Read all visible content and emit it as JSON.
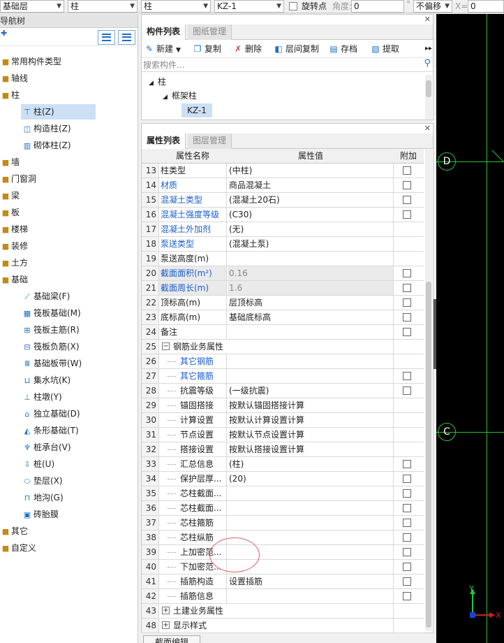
{
  "toolbar": {
    "floor": "基础层",
    "category": "柱",
    "type": "柱",
    "component": "KZ-1",
    "rotate_point": "旋转点",
    "angle_label": "角度:",
    "angle_value": "0",
    "degree": "°",
    "offset": "不偏移",
    "x_label": "X=",
    "x_value": "0"
  },
  "nav": {
    "title": "导航树",
    "items": [
      {
        "label": "常用构件类型"
      },
      {
        "label": "轴线"
      },
      {
        "label": "柱"
      },
      {
        "label": "柱(Z)"
      },
      {
        "label": "构造柱(Z)"
      },
      {
        "label": "砌体柱(Z)"
      },
      {
        "label": "墙"
      },
      {
        "label": "门窗洞"
      },
      {
        "label": "梁"
      },
      {
        "label": "板"
      },
      {
        "label": "楼梯"
      },
      {
        "label": "装修"
      },
      {
        "label": "土方"
      },
      {
        "label": "基础"
      },
      {
        "label": "基础梁(F)"
      },
      {
        "label": "筏板基础(M)"
      },
      {
        "label": "筏板主筋(R)"
      },
      {
        "label": "筏板负筋(X)"
      },
      {
        "label": "基础板带(W)"
      },
      {
        "label": "集水坑(K)"
      },
      {
        "label": "柱墩(Y)"
      },
      {
        "label": "独立基础(D)"
      },
      {
        "label": "条形基础(T)"
      },
      {
        "label": "桩承台(V)"
      },
      {
        "label": "桩(U)"
      },
      {
        "label": "垫层(X)"
      },
      {
        "label": "地沟(G)"
      },
      {
        "label": "砖胎膜"
      },
      {
        "label": "其它"
      },
      {
        "label": "自定义"
      }
    ]
  },
  "component_panel": {
    "tab_active": "构件列表",
    "tab_other": "图纸管理",
    "actions": {
      "new": "新建",
      "copy": "复制",
      "delete": "删除",
      "floor_copy": "层间复制",
      "save": "存档",
      "extract": "提取"
    },
    "search_placeholder": "搜索构件...",
    "tree": {
      "root": "柱",
      "child": "框架柱",
      "leaf": "KZ-1"
    }
  },
  "property_panel": {
    "tab_active": "属性列表",
    "tab_other": "图层管理",
    "headers": {
      "name": "属性名称",
      "value": "属性值",
      "extra": "附加"
    },
    "rows": [
      {
        "n": "13",
        "name": "柱类型",
        "value": "(中柱)"
      },
      {
        "n": "14",
        "name": "材质",
        "value": "商品混凝土"
      },
      {
        "n": "15",
        "name": "混凝土类型",
        "value": "(混凝土20石)"
      },
      {
        "n": "16",
        "name": "混凝土强度等级",
        "value": "(C30)"
      },
      {
        "n": "17",
        "name": "混凝土外加剂",
        "value": "(无)"
      },
      {
        "n": "18",
        "name": "泵送类型",
        "value": "(混凝土泵)"
      },
      {
        "n": "19",
        "name": "泵送高度(m)",
        "value": ""
      },
      {
        "n": "20",
        "name": "截面面积(m²)",
        "value": "0.16"
      },
      {
        "n": "21",
        "name": "截面周长(m)",
        "value": "1.6"
      },
      {
        "n": "22",
        "name": "顶标高(m)",
        "value": "层顶标高"
      },
      {
        "n": "23",
        "name": "底标高(m)",
        "value": "基础底标高"
      },
      {
        "n": "24",
        "name": "备注",
        "value": ""
      },
      {
        "n": "25",
        "name": "钢筋业务属性",
        "value": ""
      },
      {
        "n": "26",
        "name": "其它钢筋",
        "value": ""
      },
      {
        "n": "27",
        "name": "其它箍筋",
        "value": ""
      },
      {
        "n": "28",
        "name": "抗震等级",
        "value": "(一级抗震)"
      },
      {
        "n": "29",
        "name": "锚固搭接",
        "value": "按默认锚固搭接计算"
      },
      {
        "n": "30",
        "name": "计算设置",
        "value": "按默认计算设置计算"
      },
      {
        "n": "31",
        "name": "节点设置",
        "value": "按默认节点设置计算"
      },
      {
        "n": "32",
        "name": "搭接设置",
        "value": "按默认搭接设置计算"
      },
      {
        "n": "33",
        "name": "汇总信息",
        "value": "(柱)"
      },
      {
        "n": "34",
        "name": "保护层厚...",
        "value": "(20)"
      },
      {
        "n": "35",
        "name": "芯柱截面...",
        "value": ""
      },
      {
        "n": "36",
        "name": "芯柱截面...",
        "value": ""
      },
      {
        "n": "37",
        "name": "芯柱箍筋",
        "value": ""
      },
      {
        "n": "38",
        "name": "芯柱纵筋",
        "value": ""
      },
      {
        "n": "39",
        "name": "上加密范...",
        "value": ""
      },
      {
        "n": "40",
        "name": "下加密范...",
        "value": ""
      },
      {
        "n": "41",
        "name": "插筋构造",
        "value": "设置插筋"
      },
      {
        "n": "42",
        "name": "插筋信息",
        "value": ""
      },
      {
        "n": "43",
        "name": "土建业务属性",
        "value": ""
      },
      {
        "n": "48",
        "name": "显示样式",
        "value": ""
      }
    ]
  },
  "bottom": {
    "section_edit": "截面编辑"
  },
  "canvas": {
    "axis_d": "D",
    "axis_c": "C",
    "y_axis": "Y",
    "x_axis": "X",
    "grid_color": "#27c43a"
  }
}
